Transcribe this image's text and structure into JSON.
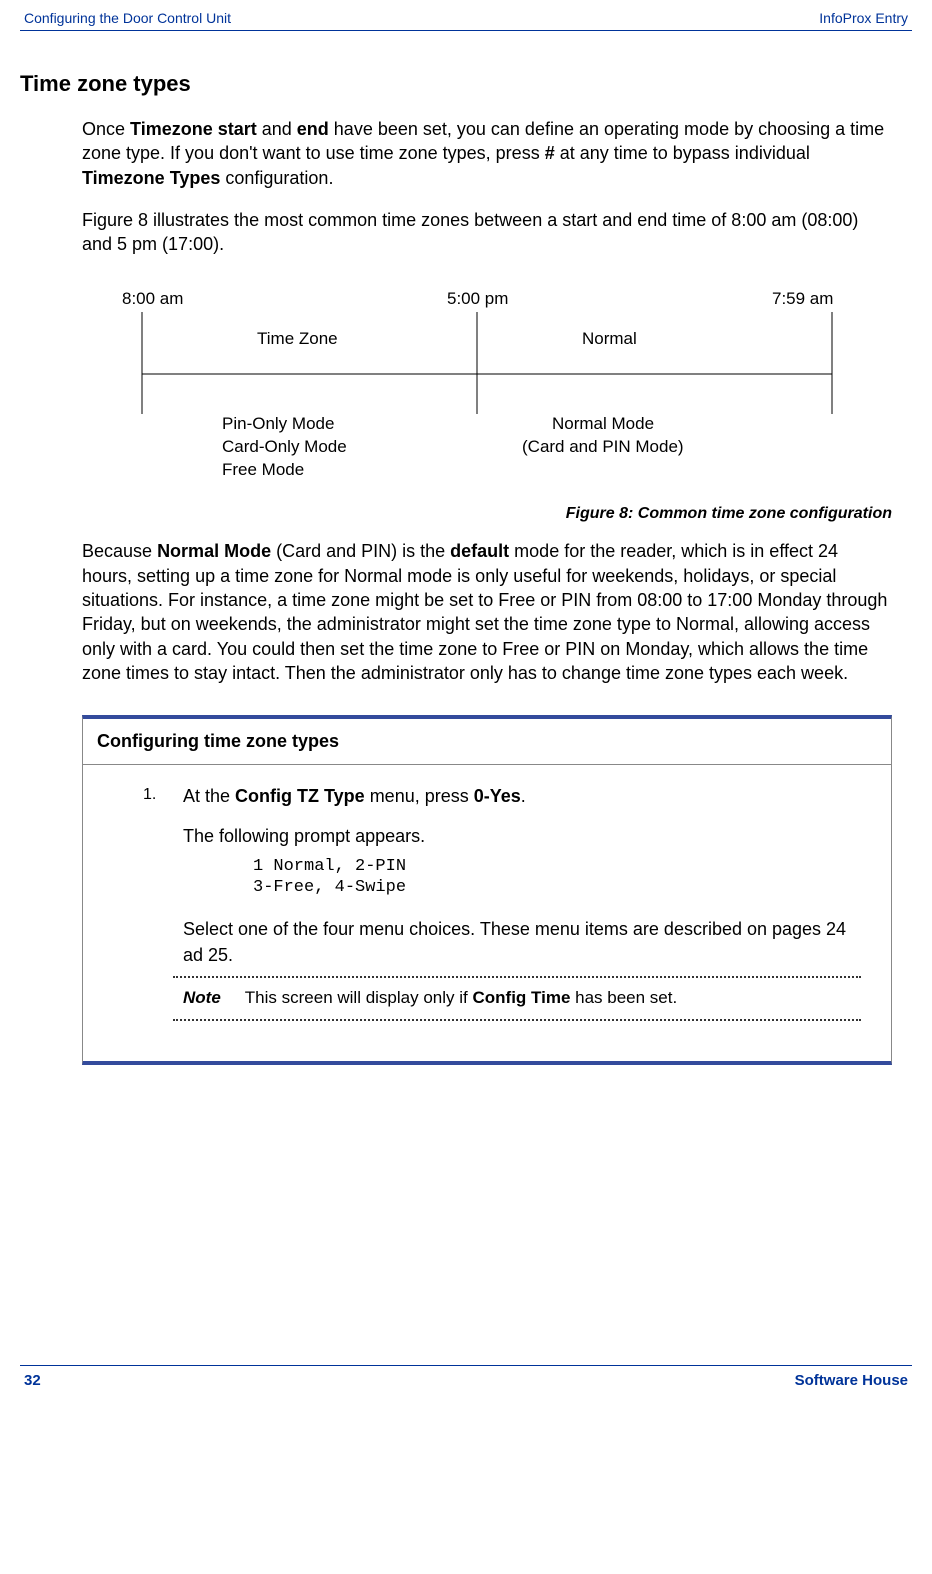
{
  "header": {
    "left": "Configuring the Door Control Unit",
    "right": "InfoProx Entry"
  },
  "footer": {
    "page": "32",
    "brand": "Software House"
  },
  "section_title": "Time zone types",
  "para1": {
    "t1": "Once ",
    "tz_start": "Timezone start",
    "t2": " and ",
    "tz_end": "end",
    "t3": " have been set, you can define an operating mode by choosing a time zone type.  If you don't want to use time zone types, press ",
    "hash": "#",
    "t4": " at any time to bypass individual ",
    "tz_types": "Timezone Types",
    "t5": " configuration."
  },
  "para2": "Figure 8 illustrates the most common time zones between a start and end time of 8:00 am (08:00) and 5 pm (17:00).",
  "figure": {
    "t800": "8:00 am",
    "t500": "5:00 pm",
    "t759": "7:59 am",
    "timezone": "Time Zone",
    "normal": "Normal",
    "pin": "Pin-Only Mode",
    "card": "Card-Only Mode",
    "free": "Free Mode",
    "normal_mode": "Normal Mode",
    "card_pin": "(Card and PIN Mode)"
  },
  "figure_caption": "Figure 8: Common time zone configuration",
  "para3": {
    "t1": "Because ",
    "normal_mode": "Normal Mode",
    "t2": " (Card and PIN) is the ",
    "default": "default",
    "t3": " mode for the reader, which is in effect 24 hours, setting up a time zone for Normal mode is only useful for weekends, holidays, or special situations. For instance, a time zone might be set to Free or PIN from 08:00 to 17:00 Monday through Friday, but on weekends, the administrator might set the time zone type to Normal, allowing access only with a card.  You could then set the time zone to Free or PIN on Monday, which allows the time zone times to stay intact. Then the administrator only has to change time zone types each week."
  },
  "proc": {
    "title": "Configuring time zone types",
    "step1_num": "1.",
    "step1": {
      "t1": "At the ",
      "menu": "Config TZ Type",
      "t2": " menu, press ",
      "key": "0-Yes",
      "t3": "."
    },
    "prompt_intro": "The following prompt appears.",
    "code": "1 Normal, 2-PIN\n3-Free, 4-Swipe",
    "select": "Select one of the four menu choices.  These menu items are described on pages 24 ad 25.",
    "note_label": "Note",
    "note": {
      "t1": "This screen will display only if ",
      "cfg": "Config Time",
      "t2": " has been set."
    }
  }
}
